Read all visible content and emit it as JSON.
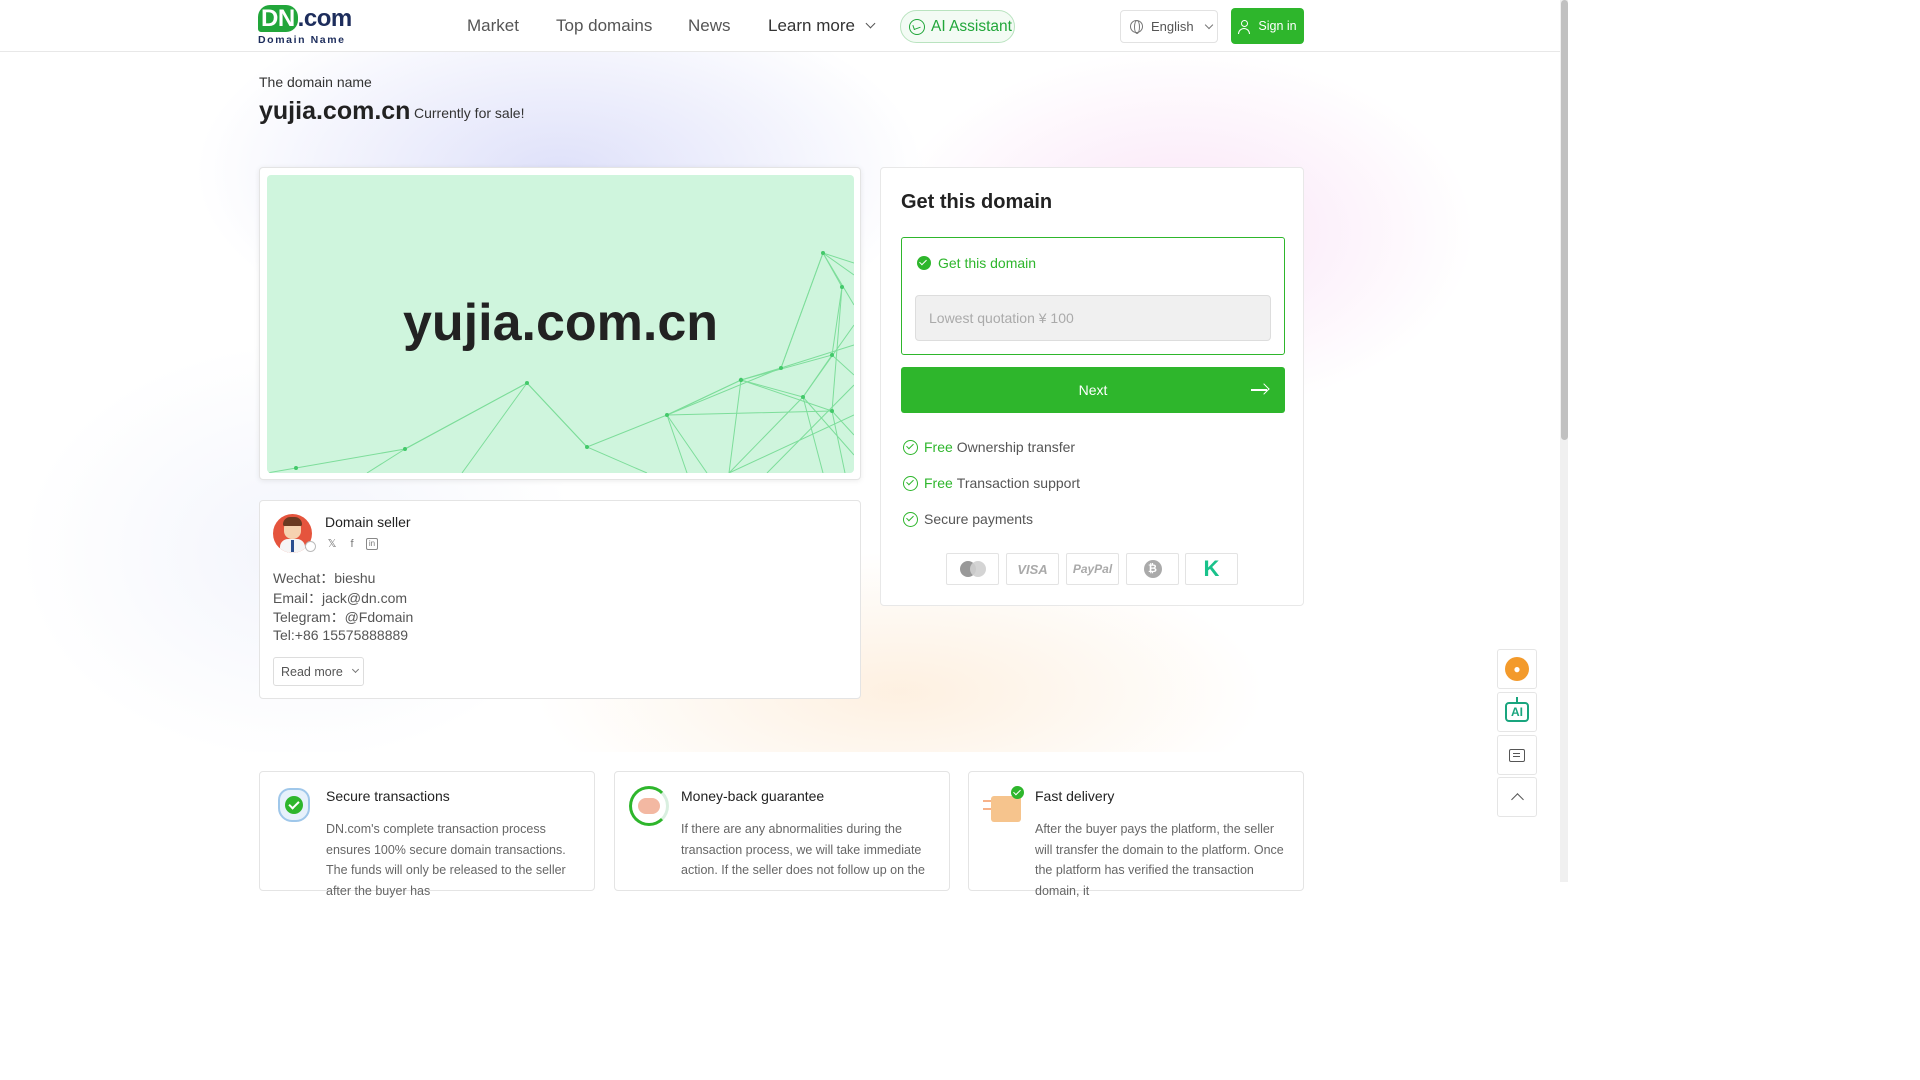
{
  "header": {
    "logo_main_dn": "DN",
    "logo_main_com": ".com",
    "logo_sub": "Domain Name",
    "nav": [
      "Market",
      "Top domains",
      "News",
      "Learn more"
    ],
    "ai_assistant": "AI Assistant",
    "language": "English",
    "sign_in": "Sign in"
  },
  "title": {
    "pre": "The domain name",
    "domain": "yujia.com.cn",
    "status": "Currently for sale!"
  },
  "banner": {
    "domain": "yujia.com.cn"
  },
  "seller": {
    "label": "Domain seller",
    "social": [
      "x-icon",
      "facebook-icon",
      "linkedin-icon"
    ],
    "wechat": "Wechat：bieshu",
    "email": "Email：jack@dn.com",
    "telegram": "Telegram：@Fdomain",
    "tel": "Tel:+86 15575888889",
    "read_more": "Read more"
  },
  "get_domain": {
    "title": "Get this domain",
    "option_label": "Get this domain",
    "quote_placeholder": "Lowest quotation ¥ 100",
    "next": "Next",
    "features": [
      {
        "free": "Free",
        "text": "Ownership transfer"
      },
      {
        "free": "Free",
        "text": "Transaction support"
      },
      {
        "free": "",
        "text": "Secure payments"
      }
    ],
    "payments": [
      "mastercard-icon",
      "VISA",
      "PayPal",
      "bitcoin-icon",
      "kucoin-icon"
    ],
    "payment_visa": "VISA",
    "payment_paypal": "PayPal",
    "payment_btc": "₿",
    "payment_kk": "K"
  },
  "side_buttons": [
    "contact-icon",
    "ai-robot-icon",
    "chat-icon",
    "back-to-top-icon"
  ],
  "side_ai_label": "AI",
  "bottom_cards": [
    {
      "icon": "shield-check-icon",
      "title": "Secure transactions",
      "desc": "DN.com's complete transaction process ensures 100% secure domain transactions. The funds will only be released to the seller after the buyer has"
    },
    {
      "icon": "money-back-icon",
      "title": "Money-back guarantee",
      "desc": "If there are any abnormalities during the transaction process, we will take immediate action. If the seller does not follow up on the"
    },
    {
      "icon": "delivery-box-icon",
      "title": "Fast delivery",
      "desc": "After the buyer pays the platform, the seller will transfer the domain to the platform. Once the platform has verified the transaction domain, it"
    }
  ],
  "colors": {
    "brand_green": "#2eb62c",
    "banner_bg": "#cff5dd",
    "logo_navy": "#1d2d5c"
  }
}
